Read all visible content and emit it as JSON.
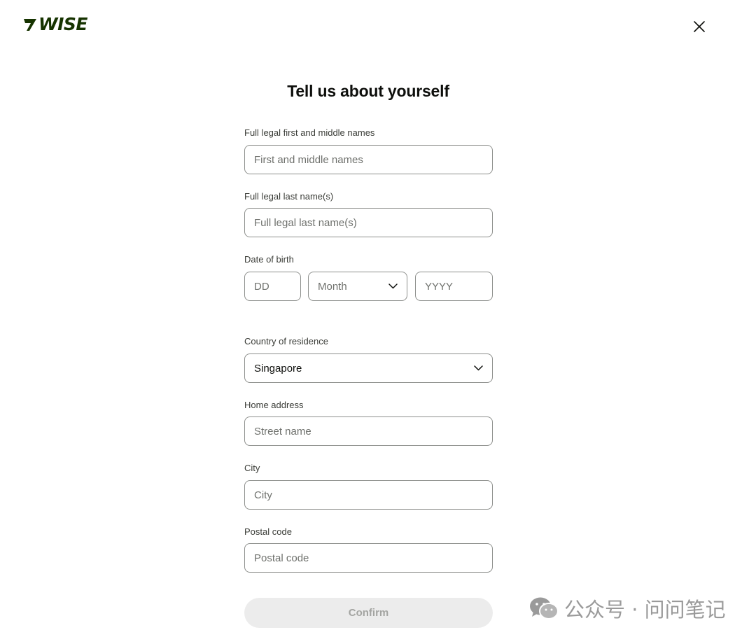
{
  "brand": {
    "logo_text": "WISE",
    "color": "#163300"
  },
  "header": {
    "close_icon": "close-icon"
  },
  "form": {
    "title": "Tell us about yourself",
    "first_names": {
      "label": "Full legal first and middle names",
      "placeholder": "First and middle names",
      "value": ""
    },
    "last_names": {
      "label": "Full legal last name(s)",
      "placeholder": "Full legal last name(s)",
      "value": ""
    },
    "dob": {
      "label": "Date of birth",
      "day_placeholder": "DD",
      "month_placeholder": "Month",
      "year_placeholder": "YYYY"
    },
    "country": {
      "label": "Country of residence",
      "value": "Singapore"
    },
    "home_address": {
      "label": "Home address",
      "placeholder": "Street name",
      "value": ""
    },
    "city": {
      "label": "City",
      "placeholder": "City",
      "value": ""
    },
    "postal_code": {
      "label": "Postal code",
      "placeholder": "Postal code",
      "value": ""
    },
    "confirm_label": "Confirm"
  },
  "watermark": {
    "text": "公众号 · 问问笔记",
    "icon": "wechat-icon"
  }
}
